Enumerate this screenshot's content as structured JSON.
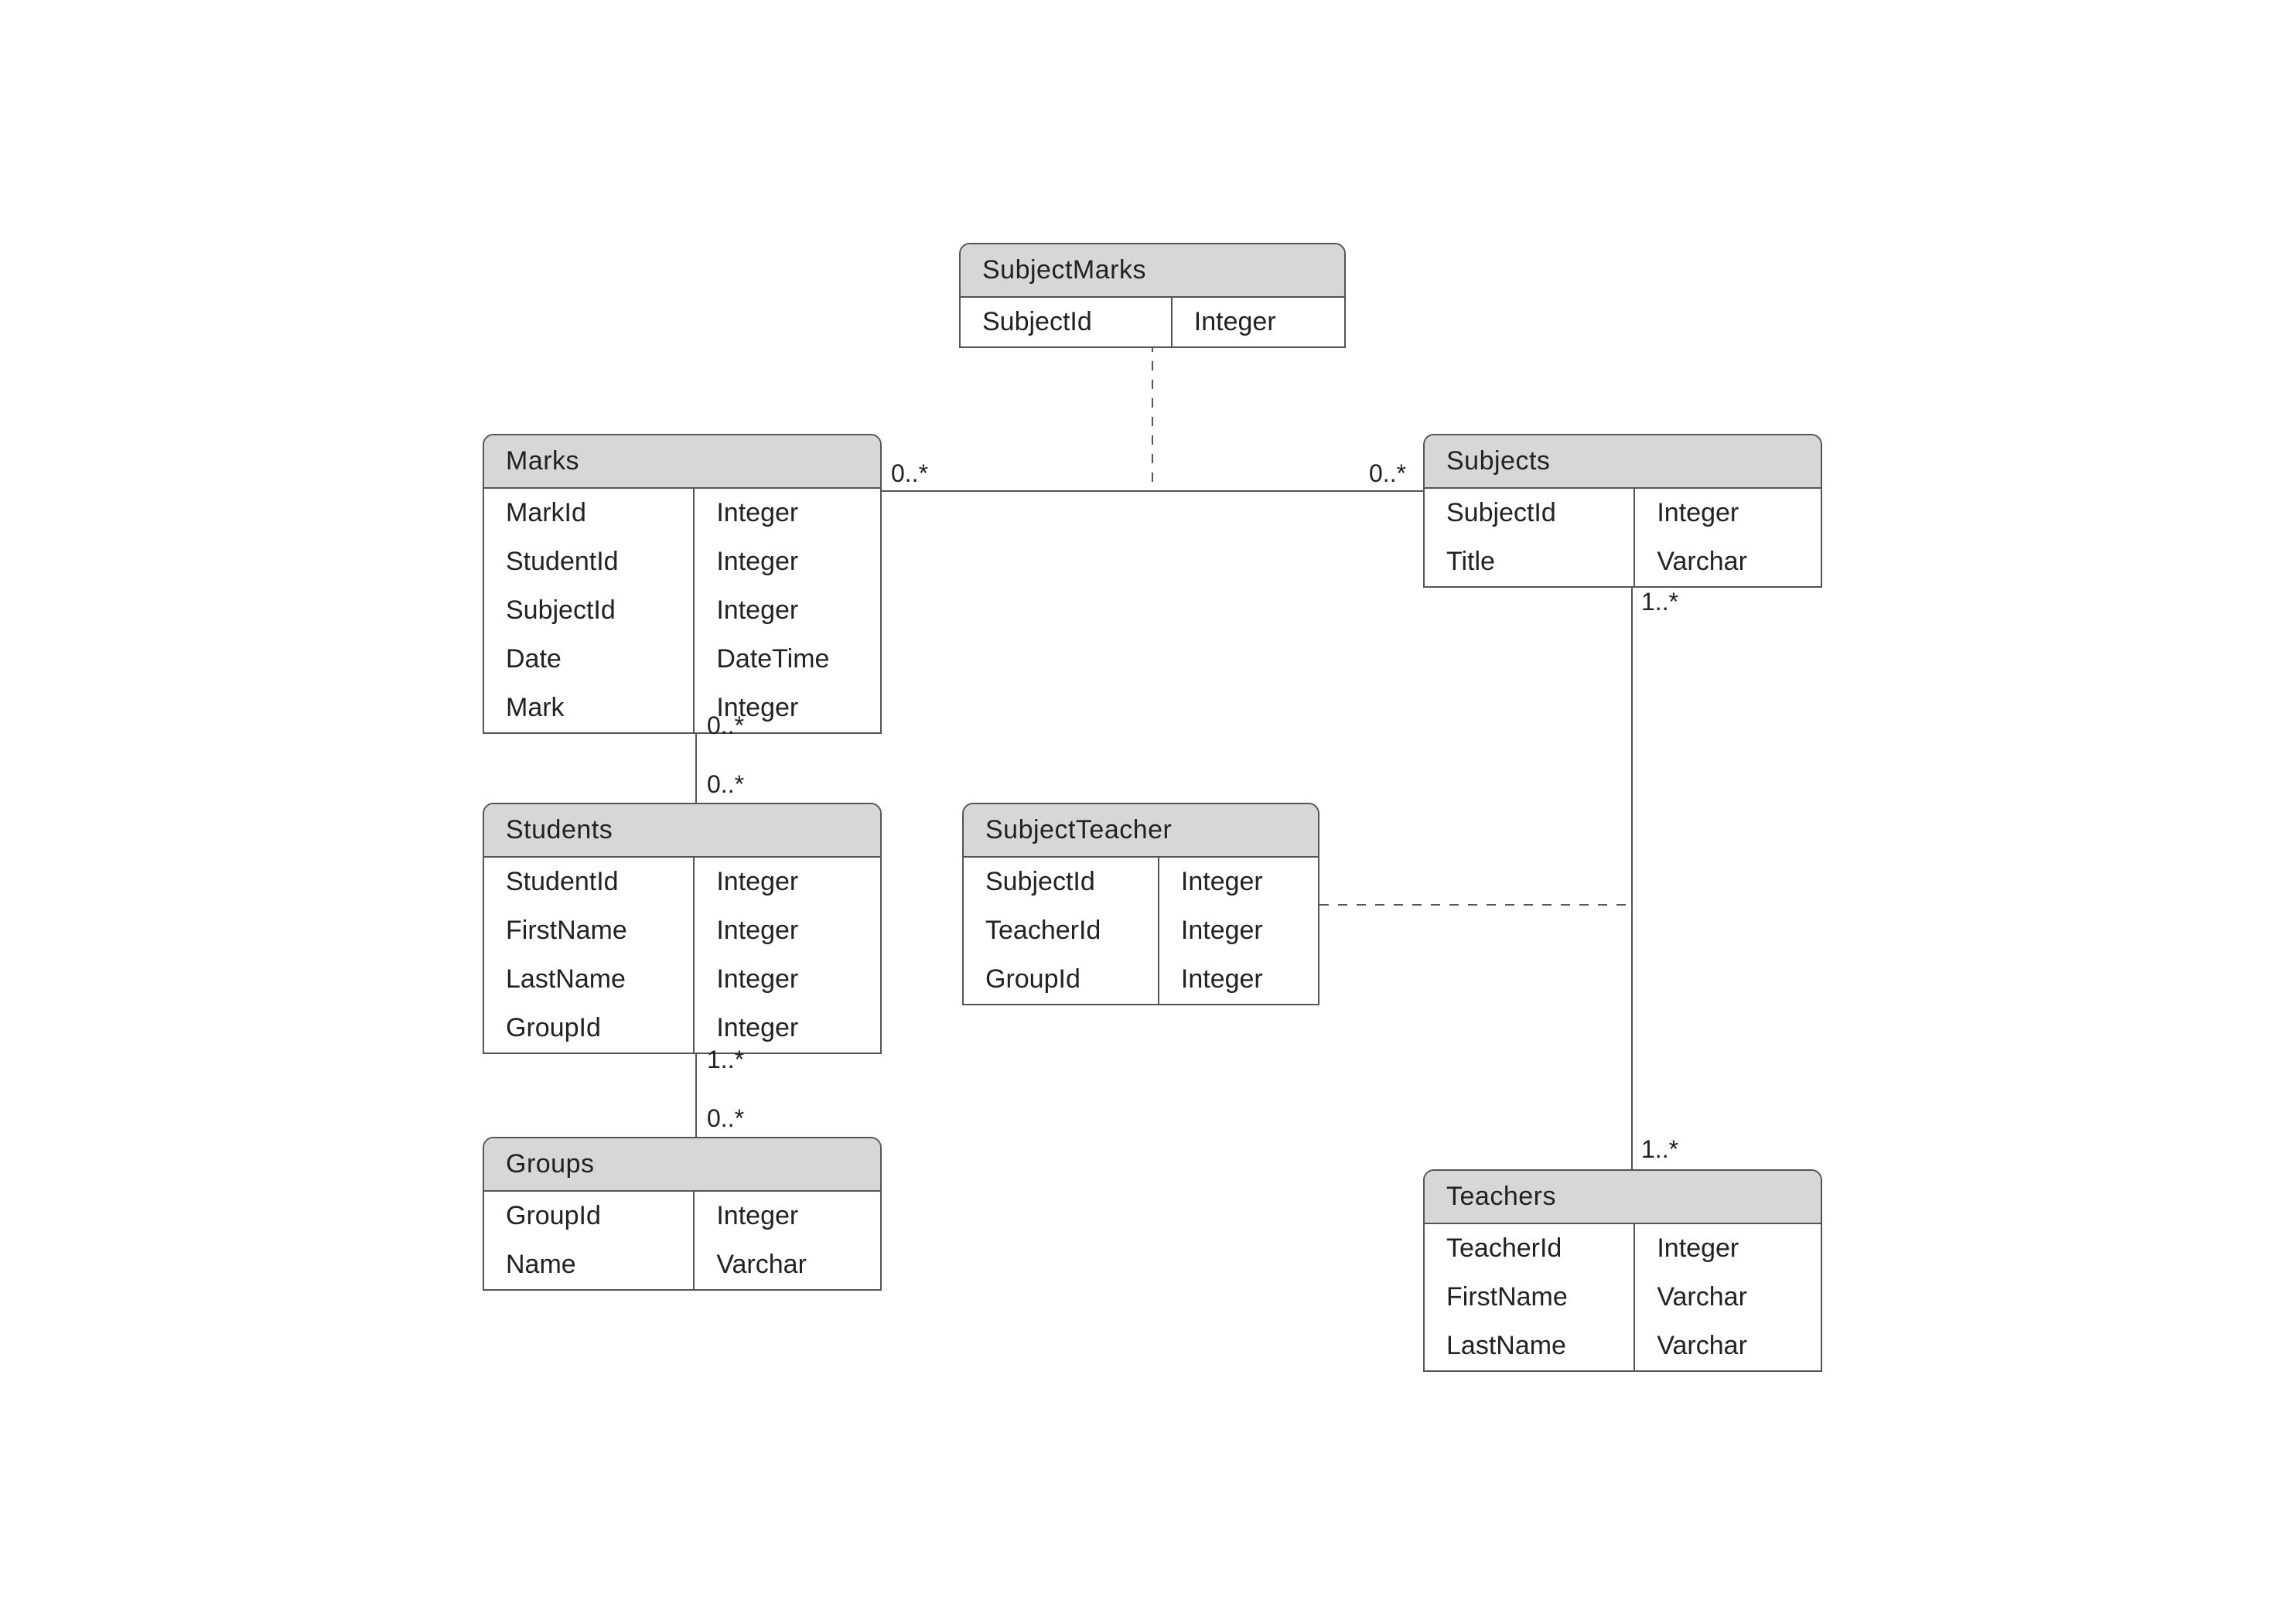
{
  "diagram": {
    "entities": {
      "subjectMarks": {
        "title": "SubjectMarks",
        "rows": [
          {
            "name": "SubjectId",
            "type": "Integer"
          }
        ]
      },
      "marks": {
        "title": "Marks",
        "rows": [
          {
            "name": "MarkId",
            "type": "Integer"
          },
          {
            "name": "StudentId",
            "type": "Integer"
          },
          {
            "name": "SubjectId",
            "type": "Integer"
          },
          {
            "name": "Date",
            "type": "DateTime"
          },
          {
            "name": "Mark",
            "type": "Integer"
          }
        ]
      },
      "subjects": {
        "title": "Subjects",
        "rows": [
          {
            "name": "SubjectId",
            "type": "Integer"
          },
          {
            "name": "Title",
            "type": "Varchar"
          }
        ]
      },
      "students": {
        "title": "Students",
        "rows": [
          {
            "name": "StudentId",
            "type": "Integer"
          },
          {
            "name": "FirstName",
            "type": "Integer"
          },
          {
            "name": "LastName",
            "type": "Integer"
          },
          {
            "name": "GroupId",
            "type": "Integer"
          }
        ]
      },
      "subjectTeacher": {
        "title": "SubjectTeacher",
        "rows": [
          {
            "name": "SubjectId",
            "type": "Integer"
          },
          {
            "name": "TeacherId",
            "type": "Integer"
          },
          {
            "name": "GroupId",
            "type": "Integer"
          }
        ]
      },
      "groups": {
        "title": "Groups",
        "rows": [
          {
            "name": "GroupId",
            "type": "Integer"
          },
          {
            "name": "Name",
            "type": "Varchar"
          }
        ]
      },
      "teachers": {
        "title": "Teachers",
        "rows": [
          {
            "name": "TeacherId",
            "type": "Integer"
          },
          {
            "name": "FirstName",
            "type": "Varchar"
          },
          {
            "name": "LastName",
            "type": "Varchar"
          }
        ]
      }
    },
    "labels": {
      "marksSubjectsLeft": "0..*",
      "marksSubjectsRight": "0..*",
      "subjectsTeachersTop": "1..*",
      "subjectsTeachersBottom": "1..*",
      "marksStudentsTop": "0..*",
      "marksStudentsBottom": "0..*",
      "studentsGroupsTop": "1..*",
      "studentsGroupsBottom": "0..*"
    }
  }
}
